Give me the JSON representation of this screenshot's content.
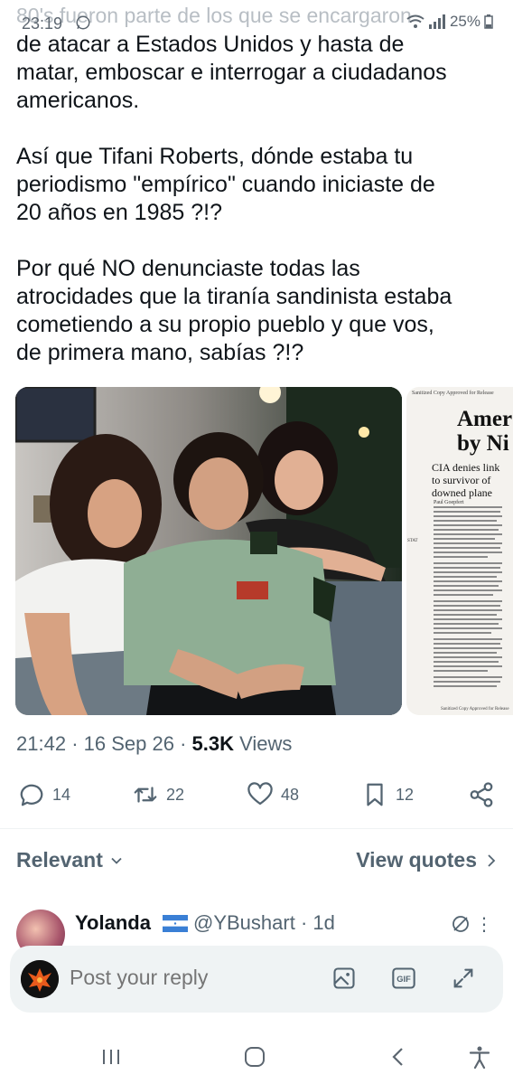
{
  "status_bar": {
    "time": "23:19",
    "battery": "25%",
    "faded_text": "80's fueron parte de los que se encargaron"
  },
  "tweet": {
    "paragraphs": [
      "de atacar a Estados Unidos y hasta de\nmatar, emboscar e interrogar a ciudadanos\namericanos.",
      "Así que Tifani Roberts, dónde estaba tu\nperiodismo \"empírico\" cuando iniciaste de\n20 años en 1985 ?!?",
      "Por qué NO denunciaste todas las\natrocidades que la tiranía sandinista estaba\ncometiendo a su propio pueblo y que vos,\nde primera mano, sabías ?!?"
    ],
    "doc_header": "Sanitized Copy Approved for Release",
    "doc_headline": "Amer\nby Ni",
    "doc_subhead": "CIA denies link\nto survivor of\ndowned plane",
    "doc_footer": "Sanitized Copy Approved for Release",
    "doc_byline": "Paul Goepfert",
    "doc_stat": "STAT",
    "time": "21:42",
    "date": "16 Sep 26",
    "views_count": "5.3K",
    "views_label": "Views"
  },
  "actions": {
    "replies": "14",
    "reposts": "22",
    "likes": "48",
    "bookmarks": "12"
  },
  "filters": {
    "sort": "Relevant",
    "view_quotes": "View quotes"
  },
  "reply": {
    "name": "Yolanda",
    "handle": "@YBushart",
    "age": "· 1d"
  },
  "composer": {
    "placeholder": "Post your reply"
  },
  "colors": {
    "text": "#0f1419",
    "secondary": "#536471",
    "composer_bg": "#eff3f4"
  }
}
